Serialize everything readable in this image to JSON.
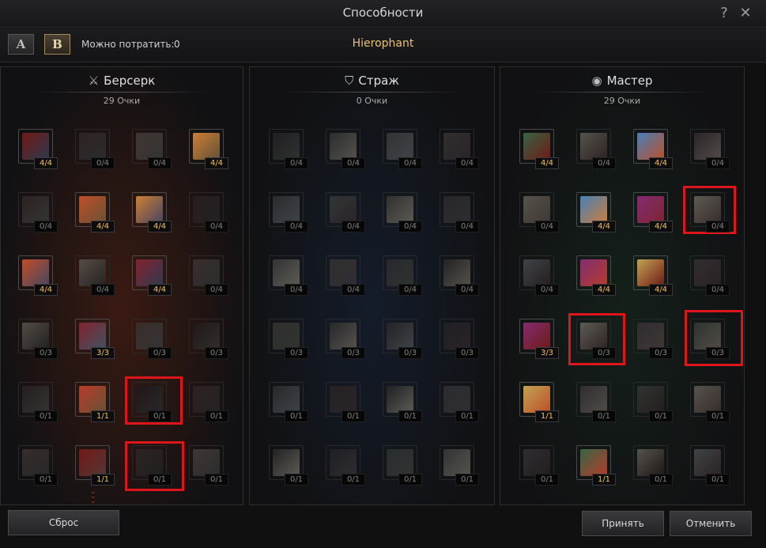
{
  "window": {
    "title": "Способности",
    "help_label": "?",
    "close_label": "✕"
  },
  "presets": [
    {
      "label": "A",
      "active": false
    },
    {
      "label": "B",
      "active": true
    }
  ],
  "points_label": "Можно потратить:",
  "points_value": "0",
  "class_name": "Hierophant",
  "trees": [
    {
      "name": "Берсерк",
      "icon": "crossed-swords-icon",
      "icon_glyph": "⚔",
      "points": "29 Очки",
      "theme": "#3a1a12",
      "skills": [
        [
          "4/4",
          "0/4",
          "0/4",
          "4/4"
        ],
        [
          "0/4",
          "4/4",
          "4/4",
          "0/4"
        ],
        [
          "4/4",
          "0/4",
          "4/4",
          "0/4"
        ],
        [
          "0/3",
          "3/3",
          "0/3",
          "0/3"
        ],
        [
          "0/1",
          "1/1",
          "0/1",
          "0/1"
        ],
        [
          "0/1",
          "1/1",
          "0/1",
          "0/1"
        ]
      ]
    },
    {
      "name": "Страж",
      "icon": "shield-icon",
      "icon_glyph": "⛉",
      "points": "0 Очки",
      "theme": "#141c2a",
      "skills": [
        [
          "0/4",
          "0/4",
          "0/4",
          "0/4"
        ],
        [
          "0/4",
          "0/4",
          "0/4",
          "0/4"
        ],
        [
          "0/4",
          "0/4",
          "0/4",
          "0/4"
        ],
        [
          "0/3",
          "0/3",
          "0/3",
          "0/3"
        ],
        [
          "0/1",
          "0/1",
          "0/1",
          "0/1"
        ],
        [
          "0/1",
          "0/1",
          "0/1",
          "0/1"
        ]
      ]
    },
    {
      "name": "Мастер",
      "icon": "eye-icon",
      "icon_glyph": "◉",
      "points": "29 Очки",
      "theme": "#14201a",
      "skills": [
        [
          "4/4",
          "0/4",
          "4/4",
          "0/4"
        ],
        [
          "0/4",
          "4/4",
          "4/4",
          "0/4"
        ],
        [
          "0/4",
          "4/4",
          "4/4",
          "0/4"
        ],
        [
          "3/3",
          "0/3",
          "0/3",
          "0/3"
        ],
        [
          "1/1",
          "0/1",
          "0/1",
          "0/1"
        ],
        [
          "0/1",
          "1/1",
          "0/1",
          "0/1"
        ]
      ]
    }
  ],
  "buttons": {
    "reset": "Сброс",
    "accept": "Принять",
    "cancel": "Отменить"
  }
}
